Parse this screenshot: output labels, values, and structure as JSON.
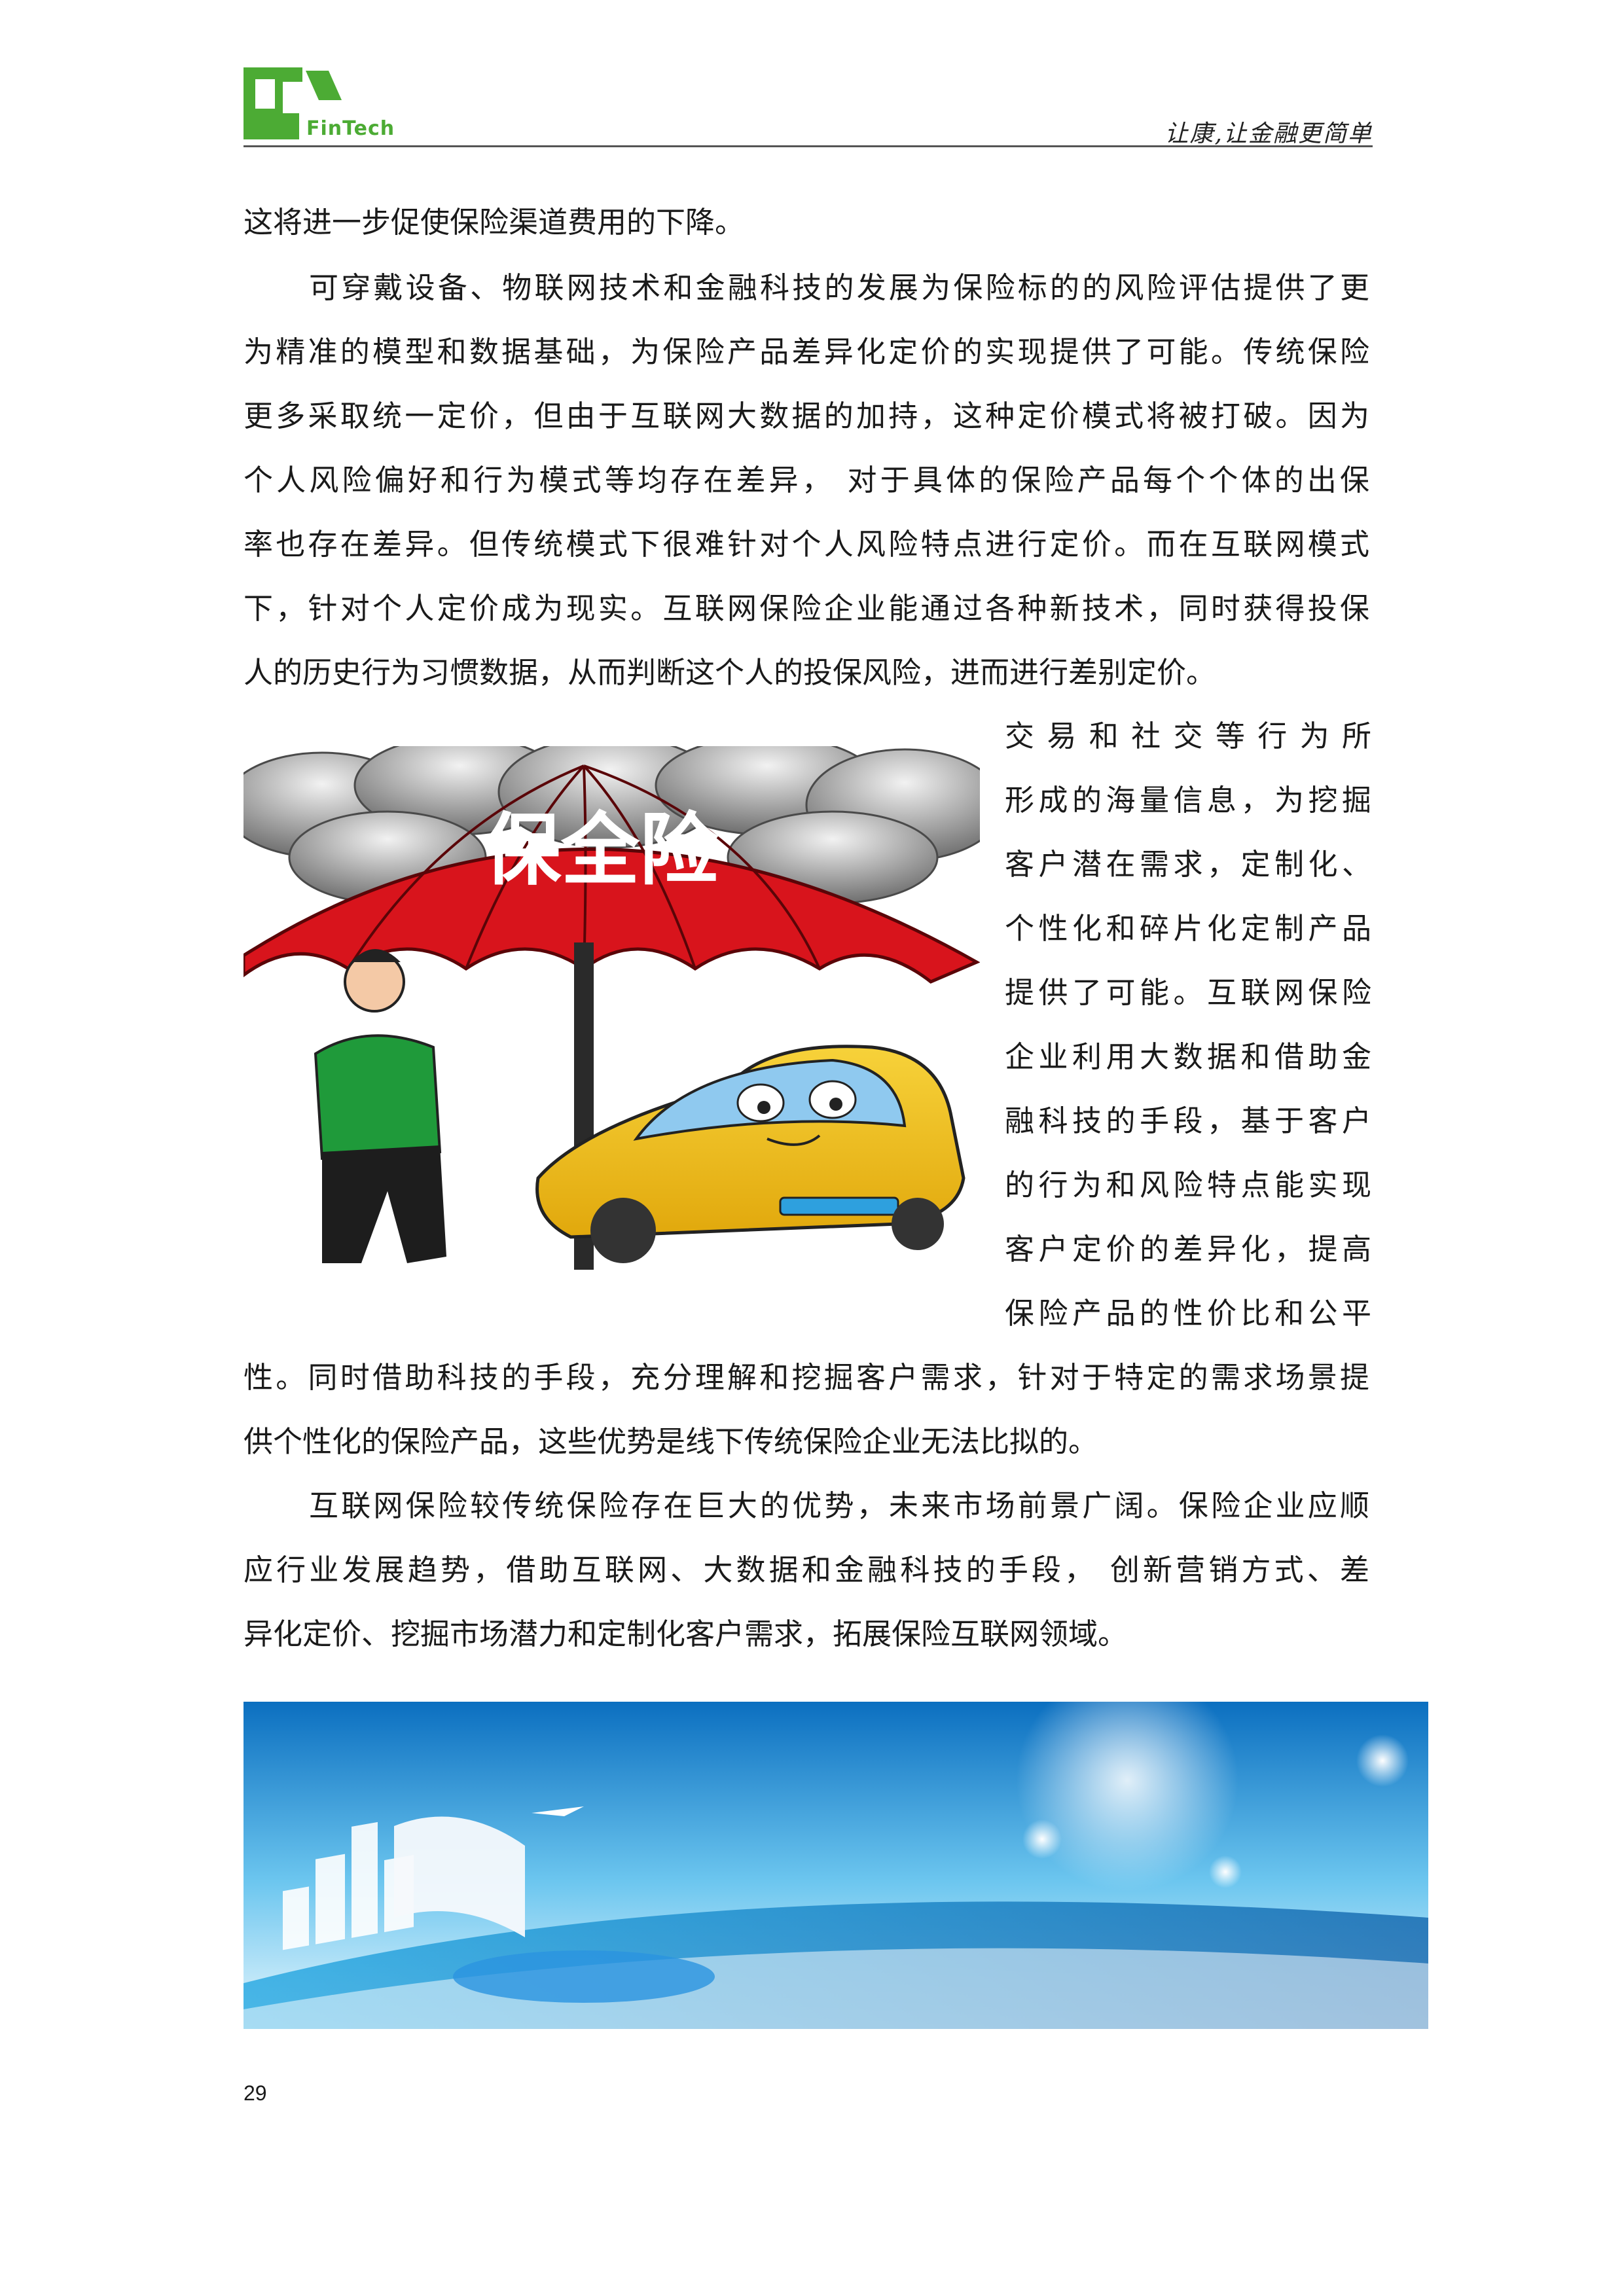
{
  "header": {
    "logo_text": "FinTech",
    "slogan": "让康,让金融更简单"
  },
  "paragraphs": {
    "lines": [
      "这将进一步促使保险渠道费用的下降。",
      "可穿戴设备、物联网技术和金融科技的发展为保险标的的风险评估提供了更",
      "为精准的模型和数据基础，为保险产品差异化定价的实现提供了可能。传统保险",
      "更多采取统一定价，但由于互联网大数据的加持，这种定价模式将被打破。因为",
      "个人风险偏好和行为模式等均存在差异，  对于具体的保险产品每个个体的出保",
      "率也存在差异。但传统模式下很难针对个人风险特点进行定价。而在互联网模式",
      "下，针对个人定价成为现实。互联网保险企业能通过各种新技术，同时获得投保",
      "人的历史行为习惯数据，从而判断这个人的投保风险，进而进行差别定价。"
    ],
    "side_lines": [
      "交易和社交等行为所",
      "形成的海量信息，为挖掘",
      "客户潜在需求，定制化、",
      "个性化和碎片化定制产品",
      "提供了可能。互联网保险",
      "企业利用大数据和借助金",
      "融科技的手段，基于客户",
      "的行为和风险特点能实现",
      "客户定价的差异化，提高",
      "保险产品的性价比和公平"
    ],
    "after_lines": [
      "性。同时借助科技的手段，充分理解和挖掘客户需求，针对于特定的需求场景提",
      "供个性化的保险产品，这些优势是线下传统保险企业无法比拟的。",
      "互联网保险较传统保险存在巨大的优势，未来市场前景广阔。保险企业应顺",
      "应行业发展趋势，借助互联网、大数据和金融科技的手段，  创新营销方式、差",
      "异化定价、挖掘市场潜力和定制化客户需求，拓展保险互联网领域。"
    ]
  },
  "illustration": {
    "umbrella_text": "保全险"
  },
  "footer": {
    "page_number": "29"
  },
  "colors": {
    "logo_green": "#4cab34",
    "umbrella_red": "#d8141c",
    "car_yellow": "#f2c21b",
    "shirt_green": "#1f9a3a"
  }
}
